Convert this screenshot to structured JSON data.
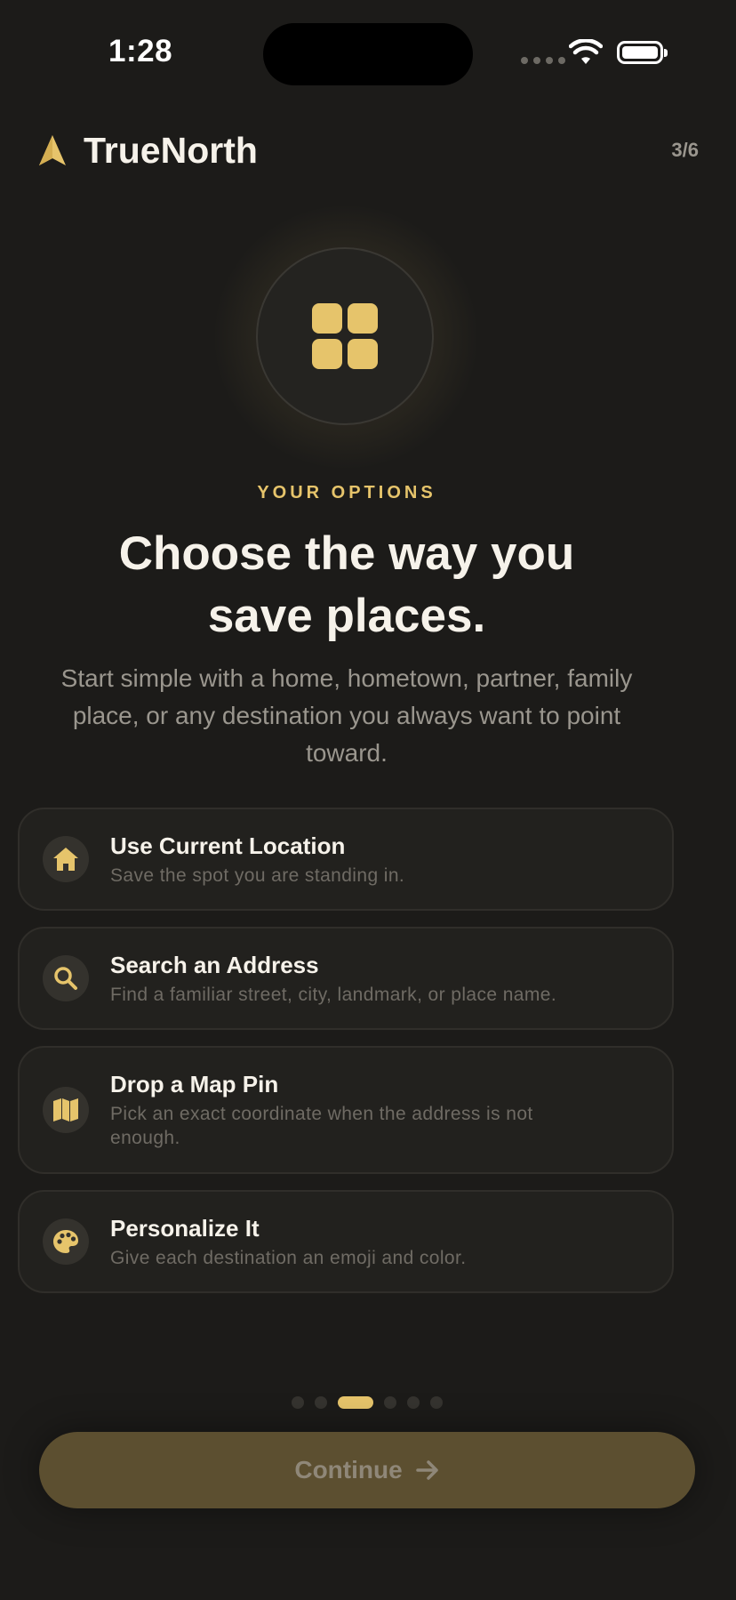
{
  "status_bar": {
    "time": "1:28"
  },
  "header": {
    "app_name": "TrueNorth",
    "step": "3/6"
  },
  "hero": {
    "icon": "grid-icon",
    "eyebrow": "YOUR OPTIONS",
    "title_line1": "Choose the way you",
    "title_line2": "save places.",
    "subtitle": "Start simple with a home, hometown, partner, family place, or any destination you always want to point toward."
  },
  "options": [
    {
      "icon": "house-icon",
      "title": "Use Current Location",
      "description": "Save the spot you are standing in."
    },
    {
      "icon": "search-icon",
      "title": "Search an Address",
      "description": "Find a familiar street, city, landmark, or place name."
    },
    {
      "icon": "map-icon",
      "title": "Drop a Map Pin",
      "description": "Pick an exact coordinate when the address is not enough."
    },
    {
      "icon": "palette-icon",
      "title": "Personalize It",
      "description": "Give each destination an emoji and color."
    }
  ],
  "pagination": {
    "total": 6,
    "current": 3
  },
  "continue": {
    "label": "Continue"
  },
  "colors": {
    "accent": "#e6c46b",
    "background": "#1c1b19",
    "button_disabled": "#5c4f30"
  }
}
